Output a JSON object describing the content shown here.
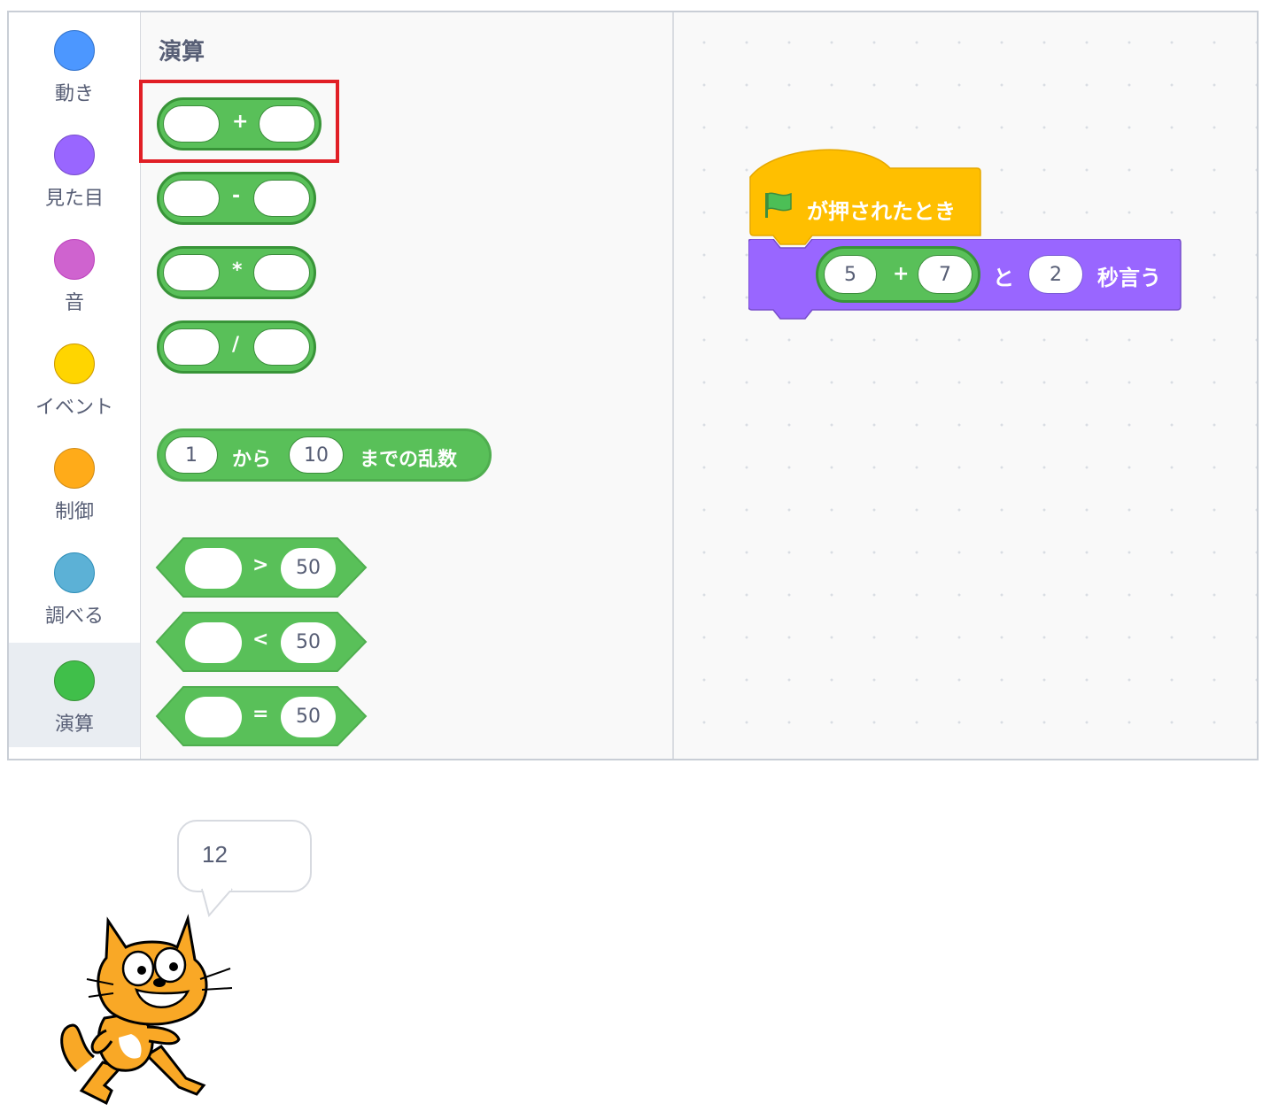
{
  "categories": [
    {
      "label": "動き",
      "color": "#4c97ff"
    },
    {
      "label": "見た目",
      "color": "#9966ff"
    },
    {
      "label": "音",
      "color": "#cf63cf"
    },
    {
      "label": "イベント",
      "color": "#ffd500"
    },
    {
      "label": "制御",
      "color": "#ffab19"
    },
    {
      "label": "調べる",
      "color": "#5cb1d6"
    },
    {
      "label": "演算",
      "color": "#40bf4a",
      "selected": true
    }
  ],
  "palette": {
    "title": "演算",
    "arithmetic_ops": [
      "+",
      "-",
      "*",
      "/"
    ],
    "random": {
      "from": "1",
      "from_label": "から",
      "to": "10",
      "to_label": "までの乱数"
    },
    "comparisons": [
      {
        "op": ">",
        "value": "50"
      },
      {
        "op": "<",
        "value": "50"
      },
      {
        "op": "=",
        "value": "50"
      }
    ]
  },
  "script": {
    "hat_label": "が押されたとき",
    "say": {
      "left_value": "5",
      "op": "+",
      "right_value": "7",
      "and_label": "と",
      "seconds": "2",
      "say_label": "秒言う"
    }
  },
  "stage": {
    "bubble_text": "12"
  },
  "colors": {
    "operators": "#59c059",
    "operators_border": "#389438",
    "events": "#ffbf00",
    "looks": "#9966ff",
    "highlight": "#e11f26"
  }
}
